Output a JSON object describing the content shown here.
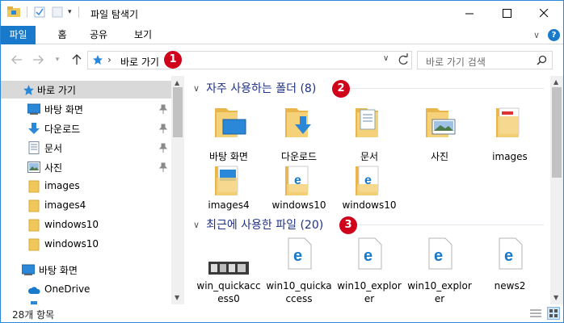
{
  "title": "파일 탐색기",
  "ribbon": {
    "tabs": [
      "파일",
      "홈",
      "공유",
      "보기"
    ]
  },
  "address": {
    "crumb": "바로 가기",
    "separator": "›"
  },
  "search": {
    "placeholder": "바로 가기 검색"
  },
  "nav": {
    "items": [
      {
        "label": "바로 가기",
        "icon": "star-icon"
      },
      {
        "label": "바탕 화면",
        "icon": "desktop-icon",
        "pinned": true
      },
      {
        "label": "다운로드",
        "icon": "download-icon",
        "pinned": true
      },
      {
        "label": "문서",
        "icon": "document-icon",
        "pinned": true
      },
      {
        "label": "사진",
        "icon": "picture-icon",
        "pinned": true
      },
      {
        "label": "images",
        "icon": "folder-icon"
      },
      {
        "label": "images4",
        "icon": "folder-icon"
      },
      {
        "label": "windows10",
        "icon": "folder-icon"
      },
      {
        "label": "windows10",
        "icon": "folder-icon"
      },
      {
        "label": "바탕 화면",
        "icon": "desktop-icon"
      },
      {
        "label": "OneDrive",
        "icon": "cloud-icon"
      }
    ]
  },
  "sections": {
    "frequent": {
      "title": "자주 사용하는 폴더 (8)"
    },
    "recent": {
      "title": "최근에 사용한 파일 (20)"
    }
  },
  "frequent_items": [
    "바탕 화면",
    "다운로드",
    "문서",
    "사진",
    "images",
    "images4",
    "windows10",
    "windows10"
  ],
  "recent_items": [
    "win_quickaccess0",
    "win10_quickaccess",
    "win10_explorer",
    "win10_explorer",
    "news2"
  ],
  "badges": [
    "1",
    "2",
    "3"
  ],
  "status": {
    "count": "28개 항목"
  },
  "colors": {
    "accent": "#1979ca",
    "badge": "#d0021b",
    "section_header": "#1e3287",
    "folder": "#f0c75a"
  }
}
